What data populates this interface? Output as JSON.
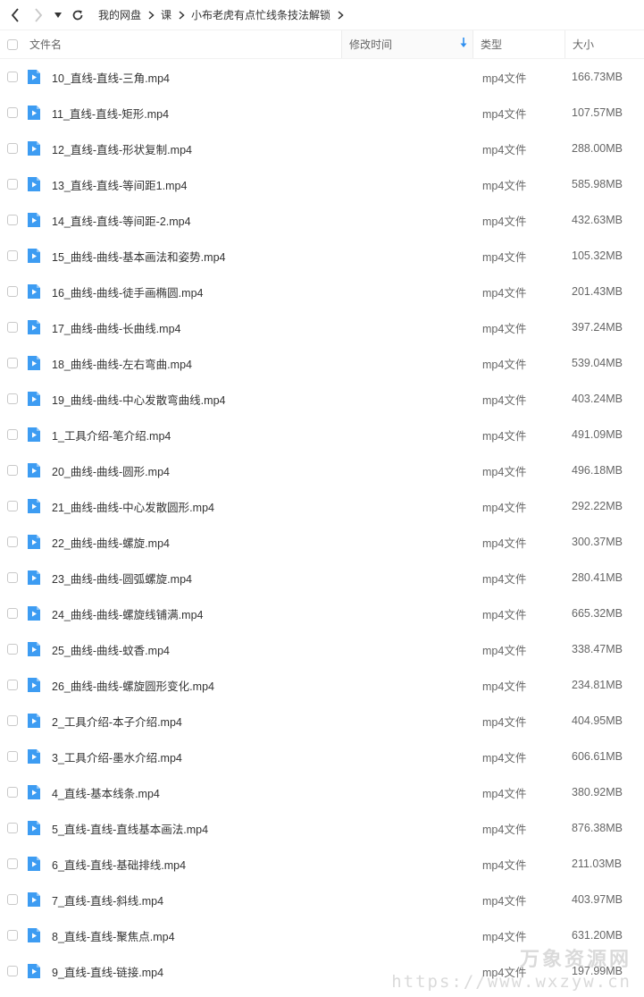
{
  "breadcrumbs": [
    "我的网盘",
    "课",
    "小布老虎有点忙线条技法解锁"
  ],
  "columns": {
    "name": "文件名",
    "modified": "修改时间",
    "type": "类型",
    "size": "大小"
  },
  "colors": {
    "accent": "#2e8ff0",
    "sort_arrow": "#2e8ff0",
    "file_icon": "#3d9cf2"
  },
  "files": [
    {
      "name": "10_直线-直线-三角.mp4",
      "type": "mp4文件",
      "size": "166.73MB"
    },
    {
      "name": "11_直线-直线-矩形.mp4",
      "type": "mp4文件",
      "size": "107.57MB"
    },
    {
      "name": "12_直线-直线-形状复制.mp4",
      "type": "mp4文件",
      "size": "288.00MB"
    },
    {
      "name": "13_直线-直线-等间距1.mp4",
      "type": "mp4文件",
      "size": "585.98MB"
    },
    {
      "name": "14_直线-直线-等间距-2.mp4",
      "type": "mp4文件",
      "size": "432.63MB"
    },
    {
      "name": "15_曲线-曲线-基本画法和姿势.mp4",
      "type": "mp4文件",
      "size": "105.32MB"
    },
    {
      "name": "16_曲线-曲线-徒手画椭圆.mp4",
      "type": "mp4文件",
      "size": "201.43MB"
    },
    {
      "name": "17_曲线-曲线-长曲线.mp4",
      "type": "mp4文件",
      "size": "397.24MB"
    },
    {
      "name": "18_曲线-曲线-左右弯曲.mp4",
      "type": "mp4文件",
      "size": "539.04MB"
    },
    {
      "name": "19_曲线-曲线-中心发散弯曲线.mp4",
      "type": "mp4文件",
      "size": "403.24MB"
    },
    {
      "name": "1_工具介绍-笔介绍.mp4",
      "type": "mp4文件",
      "size": "491.09MB"
    },
    {
      "name": "20_曲线-曲线-圆形.mp4",
      "type": "mp4文件",
      "size": "496.18MB"
    },
    {
      "name": "21_曲线-曲线-中心发散圆形.mp4",
      "type": "mp4文件",
      "size": "292.22MB"
    },
    {
      "name": "22_曲线-曲线-螺旋.mp4",
      "type": "mp4文件",
      "size": "300.37MB"
    },
    {
      "name": "23_曲线-曲线-圆弧螺旋.mp4",
      "type": "mp4文件",
      "size": "280.41MB"
    },
    {
      "name": "24_曲线-曲线-螺旋线铺满.mp4",
      "type": "mp4文件",
      "size": "665.32MB"
    },
    {
      "name": "25_曲线-曲线-蚊香.mp4",
      "type": "mp4文件",
      "size": "338.47MB"
    },
    {
      "name": "26_曲线-曲线-螺旋圆形变化.mp4",
      "type": "mp4文件",
      "size": "234.81MB"
    },
    {
      "name": "2_工具介绍-本子介绍.mp4",
      "type": "mp4文件",
      "size": "404.95MB"
    },
    {
      "name": "3_工具介绍-墨水介绍.mp4",
      "type": "mp4文件",
      "size": "606.61MB"
    },
    {
      "name": "4_直线-基本线条.mp4",
      "type": "mp4文件",
      "size": "380.92MB"
    },
    {
      "name": "5_直线-直线-直线基本画法.mp4",
      "type": "mp4文件",
      "size": "876.38MB"
    },
    {
      "name": "6_直线-直线-基础排线.mp4",
      "type": "mp4文件",
      "size": "211.03MB"
    },
    {
      "name": "7_直线-直线-斜线.mp4",
      "type": "mp4文件",
      "size": "403.97MB"
    },
    {
      "name": "8_直线-直线-聚焦点.mp4",
      "type": "mp4文件",
      "size": "631.20MB"
    },
    {
      "name": "9_直线-直线-链接.mp4",
      "type": "mp4文件",
      "size": "197.99MB"
    }
  ],
  "watermark": {
    "brand": "万象资源网",
    "url": "https://www.wxzyw.cn"
  }
}
